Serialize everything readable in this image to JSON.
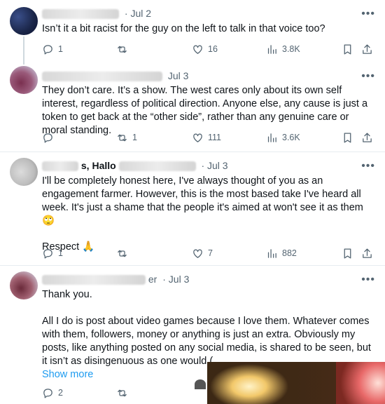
{
  "tweets": [
    {
      "handle_suffix": "@jiliver",
      "date": "· Jul 2",
      "text": [
        "Isn’t it a bit racist for the guy on the left to talk in that voice too?"
      ],
      "replies": "1",
      "retweets": "",
      "likes": "16",
      "views": "3.8K"
    },
    {
      "handle_suffix": "",
      "date": "Jul 3",
      "text": [
        "They don’t care. It’s a show. The west cares only about its own self interest, regardless of political direction. Anyone else, any cause is just a token to get back at the “other side”, rather than any genuine care or moral standing."
      ],
      "replies": "",
      "retweets": "1",
      "likes": "111",
      "views": "3.6K"
    },
    {
      "handle_suffix": "s, Hallo",
      "date": "· Jul 3",
      "text": [
        "I'll be completely honest here, I've always thought of you as an engagement farmer. However, this is the most based take I've heard all week. It's just a shame that the people it's aimed at won't see it as them 🙄",
        "Respect 🙏"
      ],
      "replies": "1",
      "retweets": "",
      "likes": "7",
      "views": "882"
    },
    {
      "handle_suffix": "er",
      "date": "· Jul 3",
      "text": [
        "Thank you.",
        "All I do is post about video games because I love them. Whatever comes with them, followers, money or anything is just an extra. Obviously my posts, like anything posted on any social media, is shared to be seen, but it isn’t as disingenuous as one would ("
      ],
      "show_more": "Show more",
      "replies": "2",
      "retweets": "",
      "likes": "",
      "views": ""
    }
  ],
  "more_label": "•••",
  "icons": {
    "reply": "reply-icon",
    "retweet": "retweet-icon",
    "like": "heart-icon",
    "views": "views-icon",
    "bookmark": "bookmark-icon",
    "share": "share-icon"
  },
  "colors": {
    "link": "#1d9bf0",
    "muted": "#536471",
    "text": "#0f1419"
  }
}
